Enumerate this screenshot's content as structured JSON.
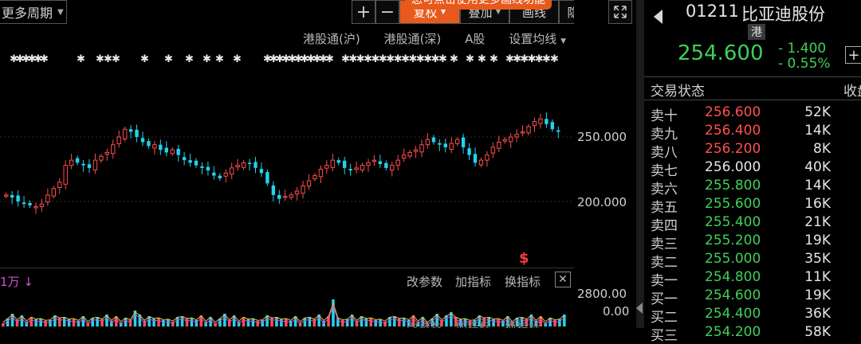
{
  "toolbar": {
    "period_label": "更多周期",
    "plus": "+",
    "minus": "−",
    "fuquan": "复权",
    "overlay": "叠加",
    "draw": "画线",
    "hide": "隐藏",
    "expand_icon": "expand-icon",
    "notice": "您可点击使用更多画线功能"
  },
  "subtoolbar": [
    "港股通(沪)",
    "港股通(深)",
    "A股",
    "设置均线"
  ],
  "chart": {
    "y_labels": [
      "250.000",
      "200.000"
    ],
    "marker": "$",
    "colors": {
      "up": "#ff4d4d",
      "down": "#22d3ee"
    }
  },
  "chart_data": {
    "type": "candlestick",
    "yticks": [
      200,
      250
    ],
    "closes": [
      205,
      203,
      200,
      198,
      197,
      196,
      198,
      205,
      210,
      215,
      228,
      232,
      230,
      228,
      226,
      232,
      235,
      238,
      244,
      250,
      256,
      254,
      250,
      246,
      243,
      244,
      240,
      238,
      240,
      236,
      232,
      230,
      228,
      226,
      224,
      220,
      218,
      222,
      226,
      228,
      230,
      229,
      226,
      222,
      214,
      205,
      202,
      204,
      205,
      208,
      212,
      216,
      220,
      225,
      228,
      232,
      230,
      226,
      224,
      226,
      228,
      230,
      232,
      229,
      226,
      228,
      232,
      236,
      238,
      240,
      244,
      248,
      246,
      244,
      242,
      245,
      248,
      242,
      236,
      230,
      232,
      236,
      242,
      246,
      248,
      250,
      252,
      254,
      258,
      262,
      264,
      260,
      256,
      254
    ]
  },
  "volume": {
    "left_label": "1万",
    "down_arrow": "↓",
    "buttons": [
      "改参数",
      "加指标",
      "换指标"
    ],
    "close": "✕",
    "y_labels": [
      "2800.00",
      "0.00"
    ],
    "bottom_buttons": [
      "改参数",
      "加指标",
      "换指标"
    ]
  },
  "quote": {
    "code": "01211",
    "name": "比亚迪股份",
    "market_tag": "港",
    "price": "254.600",
    "change": "- 1.400",
    "change_pct": "- 0.55%",
    "plus_button": "+",
    "status_label": "交易状态",
    "status_right": "收盘",
    "up_color": "#ff5050",
    "even_color": "#e6e6e6",
    "down_color": "#3fd05a"
  },
  "orderbook": [
    {
      "label": "卖十",
      "price": "256.600",
      "vol": "52K",
      "color": "up"
    },
    {
      "label": "卖九",
      "price": "256.400",
      "vol": "14K",
      "color": "up"
    },
    {
      "label": "卖八",
      "price": "256.200",
      "vol": "8K",
      "color": "up"
    },
    {
      "label": "卖七",
      "price": "256.000",
      "vol": "40K",
      "color": "even"
    },
    {
      "label": "卖六",
      "price": "255.800",
      "vol": "14K",
      "color": "down"
    },
    {
      "label": "卖五",
      "price": "255.600",
      "vol": "16K",
      "color": "down"
    },
    {
      "label": "卖四",
      "price": "255.400",
      "vol": "21K",
      "color": "down"
    },
    {
      "label": "卖三",
      "price": "255.200",
      "vol": "19K",
      "color": "down"
    },
    {
      "label": "卖二",
      "price": "255.000",
      "vol": "35K",
      "color": "down"
    },
    {
      "label": "卖一",
      "price": "254.800",
      "vol": "11K",
      "color": "down"
    },
    {
      "label": "买一",
      "price": "254.600",
      "vol": "19K",
      "color": "down"
    },
    {
      "label": "买二",
      "price": "254.400",
      "vol": "36K",
      "color": "down"
    },
    {
      "label": "买三",
      "price": "254.200",
      "vol": "58K",
      "color": "down"
    }
  ]
}
